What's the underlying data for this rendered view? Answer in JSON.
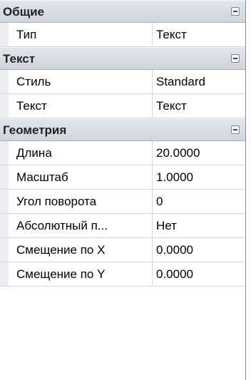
{
  "categories": [
    {
      "title": "Общие",
      "rows": [
        {
          "name": "Тип",
          "value": "Текст"
        }
      ]
    },
    {
      "title": "Текст",
      "rows": [
        {
          "name": "Стиль",
          "value": "Standard"
        },
        {
          "name": "Текст",
          "value": "Текст"
        }
      ]
    },
    {
      "title": "Геометрия",
      "rows": [
        {
          "name": "Длина",
          "value": "20.0000"
        },
        {
          "name": "Масштаб",
          "value": "1.0000"
        },
        {
          "name": "Угол поворота",
          "value": "0"
        },
        {
          "name": "Абсолютный п...",
          "value": "Нет"
        },
        {
          "name": "Смещение по X",
          "value": "0.0000"
        },
        {
          "name": "Смещение по Y",
          "value": "0.0000"
        }
      ]
    }
  ]
}
